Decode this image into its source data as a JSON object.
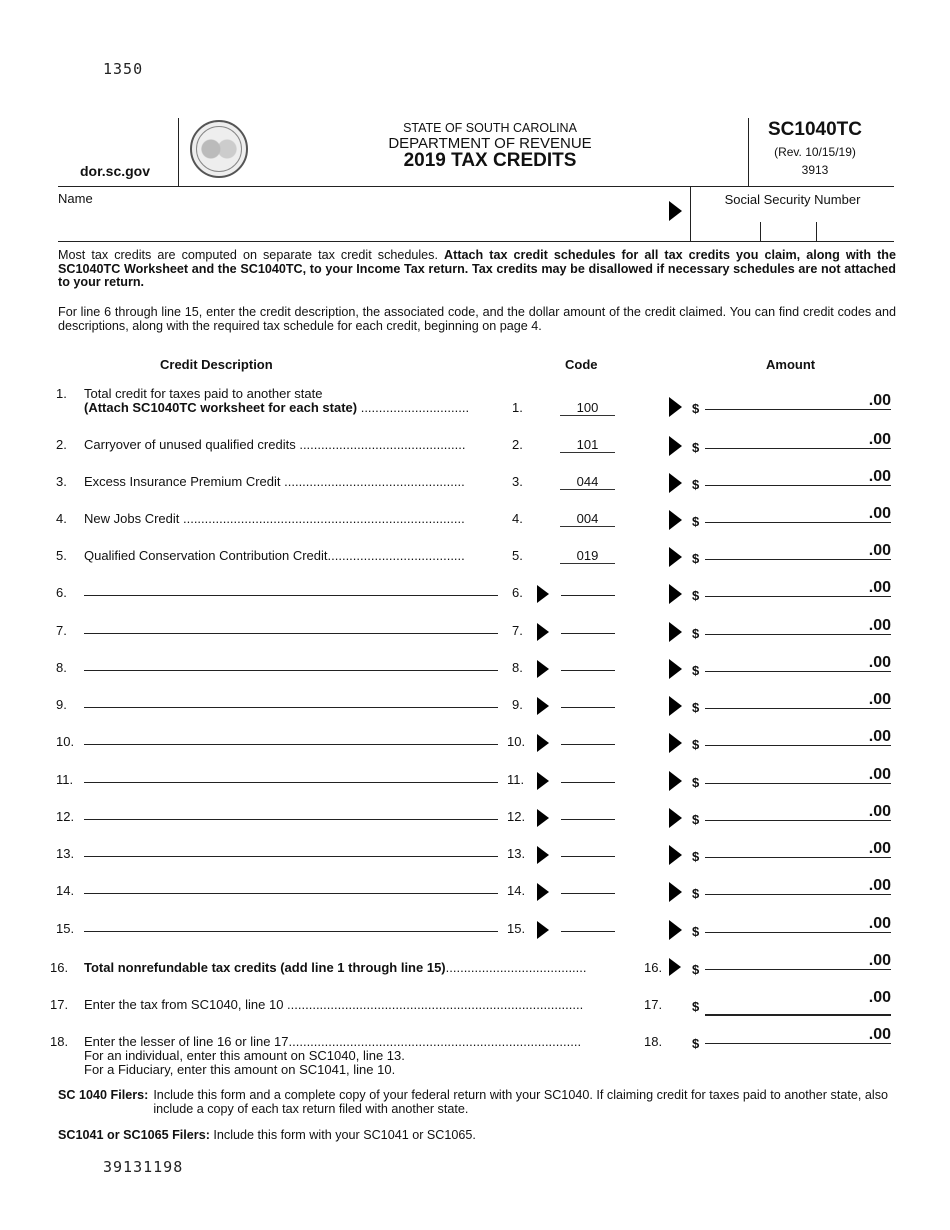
{
  "top_ocr_code": "1350",
  "bottom_ocr_code": "39131198",
  "header": {
    "website": "dor.sc.gov",
    "seal_icon": "state-seal",
    "state": "STATE OF SOUTH CAROLINA",
    "department": "DEPARTMENT OF REVENUE",
    "title": "2019 TAX CREDITS",
    "form_id": "SC1040TC",
    "revision": "(Rev. 10/15/19)",
    "form_number": "3913"
  },
  "identity": {
    "name_label": "Name",
    "name_value": "",
    "ssn_label": "Social Security Number",
    "ssn_value": ""
  },
  "instructions": {
    "para1_normal": "Most tax credits are computed on separate tax credit schedules. ",
    "para1_bold": "Attach tax credit schedules for all tax credits you claim, along with the SC1040TC Worksheet and the SC1040TC, to your Income Tax return. Tax credits may be disallowed if necessary schedules are not attached to your return.",
    "para2": "For line 6 through line 15, enter the credit description, the associated code, and the dollar amount of the credit claimed. You can find credit codes and descriptions, along with the required tax schedule for each credit, beginning on page 4."
  },
  "columns": {
    "description": "Credit Description",
    "code": "Code",
    "amount": "Amount"
  },
  "lines": [
    {
      "num": "1.",
      "desc": "Total credit for taxes paid to another state",
      "desc_bold": "(Attach SC1040TC worksheet for each state)",
      "dots": " ..............................",
      "code": "100",
      "amount": ".00"
    },
    {
      "num": "2.",
      "desc": "Carryover of unused qualified credits ..............................................",
      "code": "101",
      "amount": ".00"
    },
    {
      "num": "3.",
      "desc": "Excess Insurance Premium Credit ..................................................",
      "code": "044",
      "amount": ".00"
    },
    {
      "num": "4.",
      "desc": "New Jobs Credit ..............................................................................",
      "code": "004",
      "amount": ".00"
    },
    {
      "num": "5.",
      "desc": "Qualified Conservation Contribution Credit......................................",
      "code": "019",
      "amount": ".00"
    },
    {
      "num": "6.",
      "desc": "",
      "code": "",
      "amount": ".00"
    },
    {
      "num": "7.",
      "desc": "",
      "code": "",
      "amount": ".00"
    },
    {
      "num": "8.",
      "desc": "",
      "code": "",
      "amount": ".00"
    },
    {
      "num": "9.",
      "desc": "",
      "code": "",
      "amount": ".00"
    },
    {
      "num": "10.",
      "desc": "",
      "code": "",
      "amount": ".00"
    },
    {
      "num": "11.",
      "desc": "",
      "code": "",
      "amount": ".00"
    },
    {
      "num": "12.",
      "desc": "",
      "code": "",
      "amount": ".00"
    },
    {
      "num": "13.",
      "desc": "",
      "code": "",
      "amount": ".00"
    },
    {
      "num": "14.",
      "desc": "",
      "code": "",
      "amount": ".00"
    },
    {
      "num": "15.",
      "desc": "",
      "code": "",
      "amount": ".00"
    }
  ],
  "totals": [
    {
      "num": "16.",
      "desc_bold": "Total nonrefundable tax credits (add line 1 through line 15)",
      "dots": ".......................................",
      "amount": ".00"
    },
    {
      "num": "17.",
      "desc": "Enter the tax from SC1040, line 10 ..................................................................................",
      "amount": ".00"
    },
    {
      "num": "18.",
      "desc": "Enter the lesser of line 16 or line 17.................................................................................",
      "note1": "For an individual, enter this amount on SC1040, line 13.",
      "note2": "For a Fiduciary, enter this amount on SC1041, line 10.",
      "amount": ".00"
    }
  ],
  "currency_symbol": "$",
  "footer": {
    "sc1040_label": "SC 1040 Filers:",
    "sc1040_text": "Include this form and a complete copy of your federal return with your SC1040. If claiming credit for taxes paid to another state, also include a copy of each tax return filed with another state.",
    "sc1041_label": "SC1041 or SC1065 Filers:",
    "sc1041_text": "Include this form with your SC1041 or SC1065."
  }
}
